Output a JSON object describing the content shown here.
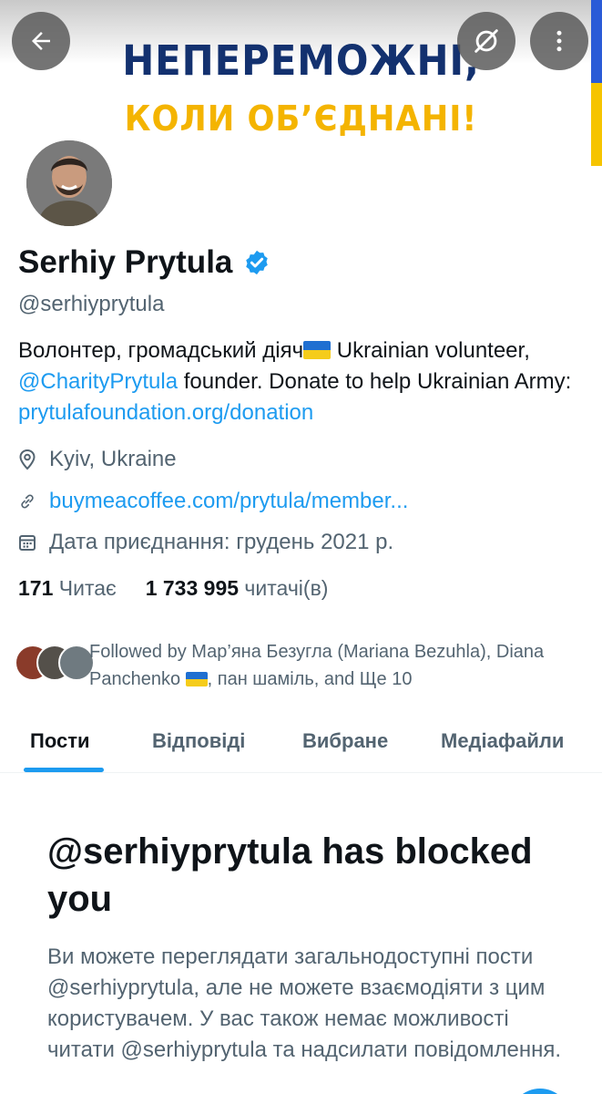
{
  "banner": {
    "line1": "НЕПЕРЕМОЖНІ,",
    "line2": "КОЛИ ОБ’ЄДНАНІ!"
  },
  "header_buttons": {
    "back_icon": "arrow-left-icon",
    "visibility_icon": "eye-slash-icon",
    "more_icon": "vertical-ellipsis-icon"
  },
  "profile": {
    "name": "Serhiy Prytula",
    "handle": "@serhiyprytula",
    "bio": {
      "part1": "Волонтер, громадський діяч",
      "part2": " Ukrainian volunteer, ",
      "mention": "@CharityPrytula",
      "part3": " founder. Donate to help Ukrainian Army: ",
      "link": "prytulafoundation.org/donation"
    },
    "location": "Kyiv, Ukraine",
    "website": "buymeacoffee.com/prytula/member...",
    "joined": "Дата приєднання: грудень 2021 р."
  },
  "stats": {
    "following_count": "171",
    "following_label": "Читає",
    "followers_count": "1 733 995",
    "followers_label": "читачі(в)"
  },
  "followed_by": {
    "text_before_flag": "Followed by Мар’яна Безугла (Mariana Bezuhla), Diana Panchenko",
    "text_after_flag": ", пан шаміль, and Ще 10"
  },
  "tabs": [
    {
      "label": "Пости",
      "active": true
    },
    {
      "label": "Відповіді",
      "active": false
    },
    {
      "label": "Вибране",
      "active": false
    },
    {
      "label": "Медіафайли",
      "active": false
    }
  ],
  "blocked": {
    "title": "@serhiyprytula has blocked you",
    "body": "Ви можете переглядати загальнодоступні пости @serhiyprytula, але не можете взаємодіяти з цим користувачем. У вас також немає можливості читати @serhiyprytula та надсилати повідомлення."
  },
  "colors": {
    "accent": "#1d9bf0",
    "secondary_text": "#536471",
    "primary_text": "#0f1419",
    "banner_blue": "#13316f",
    "banner_yellow": "#f4b400"
  }
}
